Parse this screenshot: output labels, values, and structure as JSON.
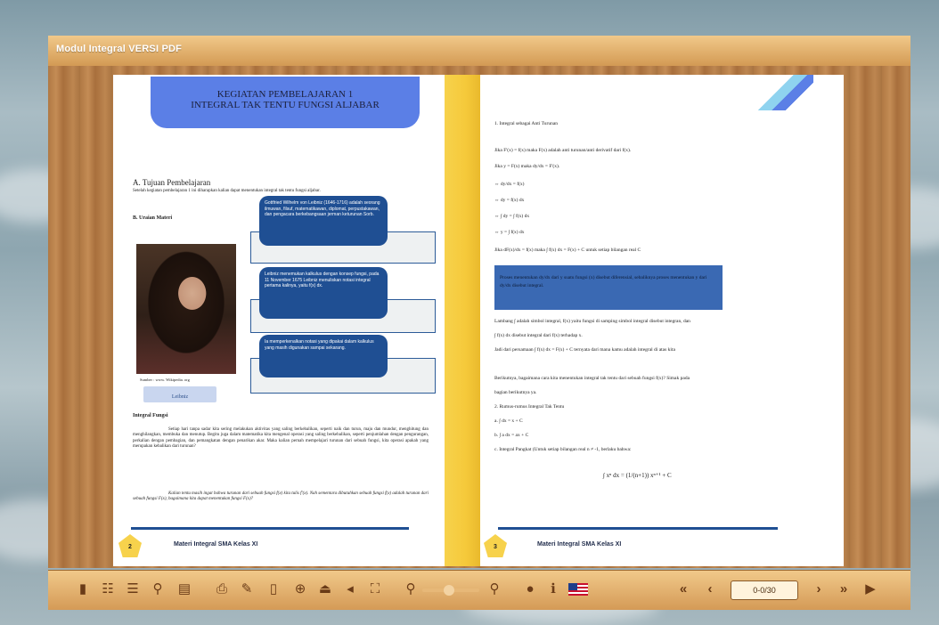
{
  "window": {
    "title": "Modul Integral VERSI PDF"
  },
  "left_page": {
    "heading_line1": "KEGIATAN PEMBELAJARAN 1",
    "heading_line2": "INTEGRAL TAK TENTU FUNGSI ALJABAR",
    "section_a_title": "A.   Tujuan Pembelajaran",
    "section_a_text": "Setelah kegiatan pembelajaran 1 ini diharapkan kalian dapat menentukan integral tak tentu fungsi aljabar.",
    "section_b_title": "B.  Uraian Materi",
    "portrait_caption": "Sumber : www.  Wikipedia. org",
    "portrait_button": "Leibniz",
    "bio_box_1": "Gottfried Wilhelm von Leibniz (1646-1716) adalah seorang ilmuwan, filsuf, matematikawan, diplomat, perpustakawan, dan pengacara berkebangsaan jerman keturunan Sorb.",
    "bio_box_2": "Leibniz menemukan kalkulus dengan konsep fungsi, pada 11 November 1675 Leibniz menuliskan notasi integral pertama kalinya, yaitu f(x) dx.",
    "bio_box_3": "Ia memperkenalkan notasi yang dipakai dalam kalkulus yang masih digunakan sampai sekarang.",
    "subheading": "Integral Fungsi",
    "paragraph_1": "Setiap hari tanpa sadar kita sering melakukan aktivitas yang saling berkebalikan, seperti naik dan turun, maju dan mundur, menghitung dan menghilangkan, membuka dan menutup. Begitu juga dalam matematika kita mengenal operasi yang saling berkebalikan, seperti penjumlahan dengan pengurangan, perkalian dengan pembagian, dan pemangkatan dengan penarikan akar. Maka kalian pernah mempelajari turunan dari sebuah fungsi, kita operasi apakah yang merupakan kebalikan dari turunan?",
    "paragraph_2": "Kalian tentu masih ingat bahwa turunan dari sebuah fungsi f(x) kita tulis f'(x). Nah sementara dibutuhkan sebuah fungsi f(x) adalah turunan dari sebuah fungsi F(x), bagaimana kita dapat menentukan fungsi F(x)?",
    "footer_page_number": "2",
    "footer_text": "Materi Integral SMA Kelas XI"
  },
  "right_page": {
    "line_1": "1. Integral sebagai Anti Turunan",
    "line_2": "Jika F'(x) = f(x) maka F(x) adalah anti turunan/anti derivatif dari f(x).",
    "line_3": "Jika y = F(x) maka dy/dx = F'(x).",
    "step_1": "⇔ dy/dx = f(x)",
    "step_2": "⇔ dy = f(x) dx",
    "step_3": "⇔ ∫ dy = ∫ f(x) dx",
    "step_4": "⇔ y = ∫ f(x) dx",
    "line_4": "Jika dF(x)/dx = f(x) maka ∫ f(x) dx = F(x) + C untuk setiap bilangan real C",
    "highlight_text": "Proses menentukan dy/dx dari y suatu fungsi (x) disebut diferensial, sebaliknya proses menentukan y dari dy/dx disebut integral.",
    "line_5": "Lambang ∫ adalah simbol integral, f(x) yaitu fungsi di samping simbol integral disebut integran, dan",
    "line_6": "∫ f(x) dx disebut integral dari f(x) terhadap x.",
    "line_7": "Jadi dari persamaan ∫ f(x) dx = F(x) + C ternyata dari mana kamu adalah integral di atas kita",
    "line_8": "Berikutnya, bagaimana cara kita menentukan integral tak tentu dari sebuah fungsi f(x)? Simak pada",
    "line_9": "bagian berikutnya ya.",
    "line_10": "2. Rumus-rumus Integral Tak Tentu",
    "item_a": "a.  ∫ dx = x + C",
    "item_b": "b.  ∫ a dx = ax + C",
    "item_c": "c.  Integral Pangkat (Untuk setiap bilangan real n ≠ -1, berlaku bahwa:",
    "formula": "∫ xⁿ dx = (1/(n+1)) xⁿ⁺¹ + C",
    "footer_page_number": "3",
    "footer_text": "Materi Integral SMA Kelas XI"
  },
  "toolbar": {
    "page_indicator": "0-0/30"
  },
  "icons": {
    "prev_page": "chevron-left-icon",
    "next_page": "chevron-right-icon",
    "first_page": "skip-first-icon",
    "last_page": "skip-last-icon"
  },
  "colors": {
    "accent_blue": "#1f4f93",
    "heading_blue": "#5b7fe6",
    "yellow": "#f7d24c",
    "wood": "#b07944"
  }
}
